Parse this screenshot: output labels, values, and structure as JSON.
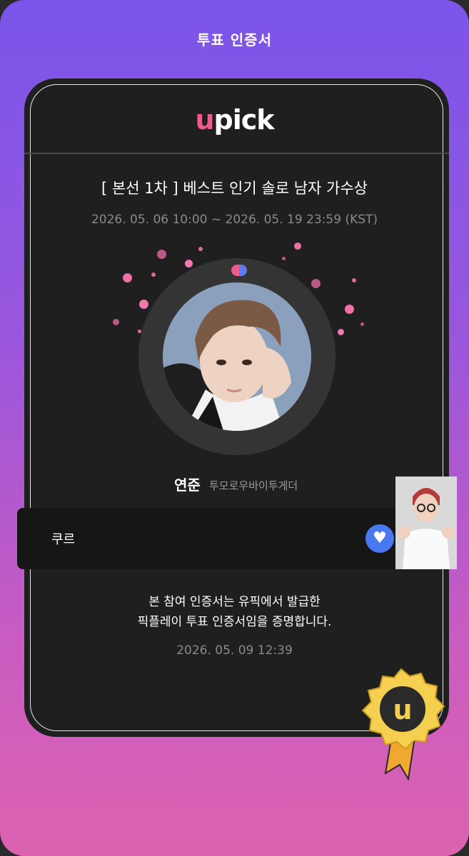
{
  "header": {
    "title": "투표 인증서"
  },
  "logo": {
    "prefix": "u",
    "rest": "pick"
  },
  "vote": {
    "title": "[ 본선 1차 ] 베스트 인기 솔로 남자 가수상",
    "period": "2026. 05. 06 10:00 ~ 2026. 05. 19 23:59 (KST)"
  },
  "artist": {
    "name": "연준",
    "group": "투모로우바이투게더"
  },
  "voter": {
    "name": "쿠르"
  },
  "certificate": {
    "line1": "본 참여 인증서는 유픽에서 발급한",
    "line2": "픽플레이 투표 인증서임을 증명합니다.",
    "issued": "2026. 05. 09 12:39"
  },
  "colors": {
    "accent_pink": "#f05a8c",
    "accent_blue": "#4a78f0",
    "gold": "#f2c230"
  },
  "icons": {
    "vote": "heart-icon",
    "medal": "medal-badge-icon",
    "toggle": "pink-blue-pill-icon"
  }
}
